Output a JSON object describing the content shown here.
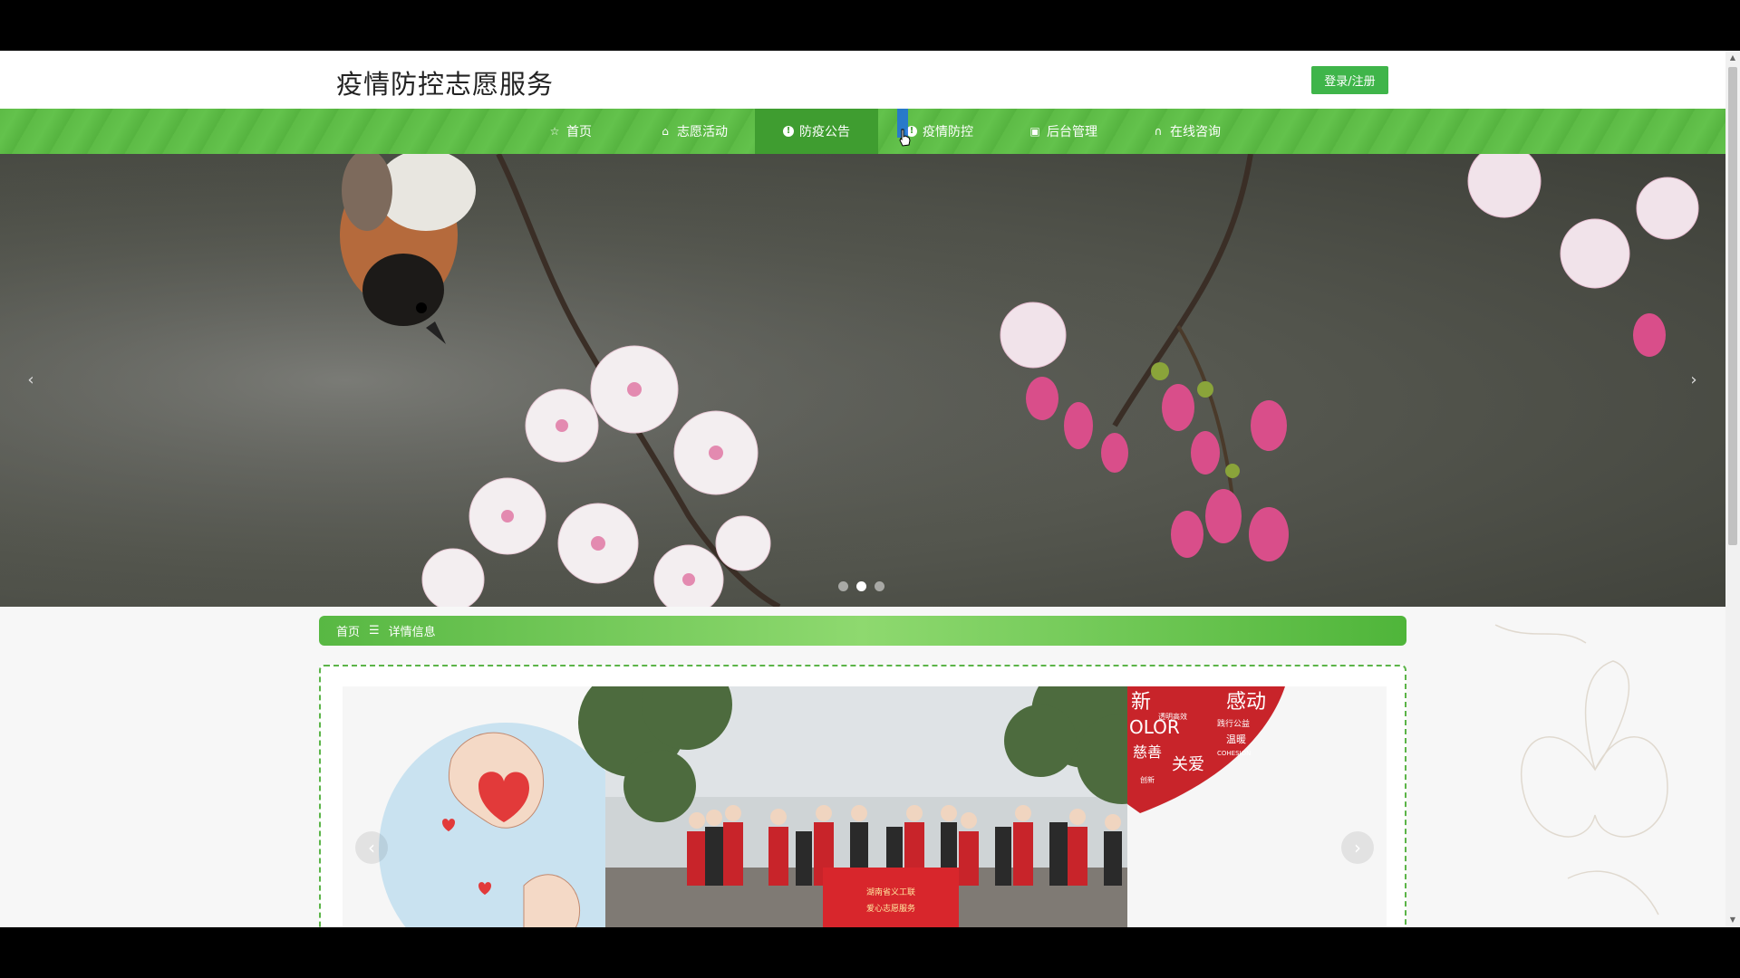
{
  "header": {
    "site_title": "疫情防控志愿服务",
    "login_label": "登录/注册"
  },
  "nav": {
    "items": [
      {
        "label": "首页",
        "icon": "star-icon"
      },
      {
        "label": "志愿活动",
        "icon": "bag-icon"
      },
      {
        "label": "防疫公告",
        "icon": "info-circle-icon",
        "active": true
      },
      {
        "label": "疫情防控",
        "icon": "info-circle-icon"
      },
      {
        "label": "后台管理",
        "icon": "clipboard-icon"
      },
      {
        "label": "在线咨询",
        "icon": "headset-icon"
      }
    ]
  },
  "hero": {
    "prev_icon": "‹",
    "next_icon": "›",
    "slide_count": 3,
    "active_slide": 2
  },
  "breadcrumb": {
    "home": "首页",
    "separator": "☰",
    "current": "详情信息"
  },
  "gallery": {
    "prev_icon": "‹",
    "next_icon": "›",
    "words_right": [
      "新",
      "感动",
      "OLOR",
      "慈善",
      "关爱",
      "温暖",
      "践行公益",
      "透明高效",
      "COHESION",
      "创新"
    ],
    "banner_text": [
      "湖南省义工联",
      "爱心志愿服务"
    ]
  },
  "colors": {
    "brand_green": "#3fb54a",
    "nav_active": "#3f9d30",
    "breadcrumb_green": "#58b843",
    "panel_border": "#5bb448"
  }
}
